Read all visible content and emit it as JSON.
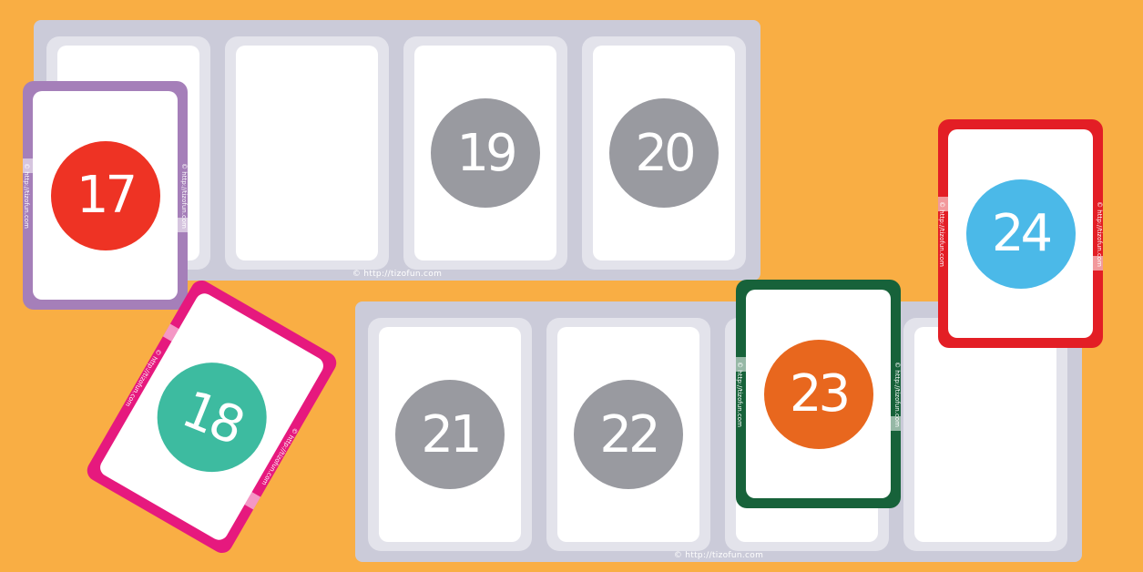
{
  "copyright": "© http://tizofun.com",
  "card_copyright": "© http://tizofun.com",
  "board_top": {
    "slots": [
      {
        "number": ""
      },
      {
        "number": ""
      },
      {
        "number": "19"
      },
      {
        "number": "20"
      }
    ]
  },
  "board_bottom": {
    "slots": [
      {
        "number": "21"
      },
      {
        "number": "22"
      },
      {
        "number": ""
      },
      {
        "number": ""
      }
    ]
  },
  "cards": [
    {
      "number": "17",
      "border_color": "#A57FB9",
      "circle_color": "#EE3324"
    },
    {
      "number": "18",
      "border_color": "#E6197E",
      "circle_color": "#3DBBA0"
    },
    {
      "number": "23",
      "border_color": "#17623A",
      "circle_color": "#E8671E"
    },
    {
      "number": "24",
      "border_color": "#E31E25",
      "circle_color": "#4BB9E8"
    }
  ],
  "colors": {
    "background": "#F9AE44",
    "board": "#CBCBD9",
    "placeholder_circle": "#999AA0"
  }
}
